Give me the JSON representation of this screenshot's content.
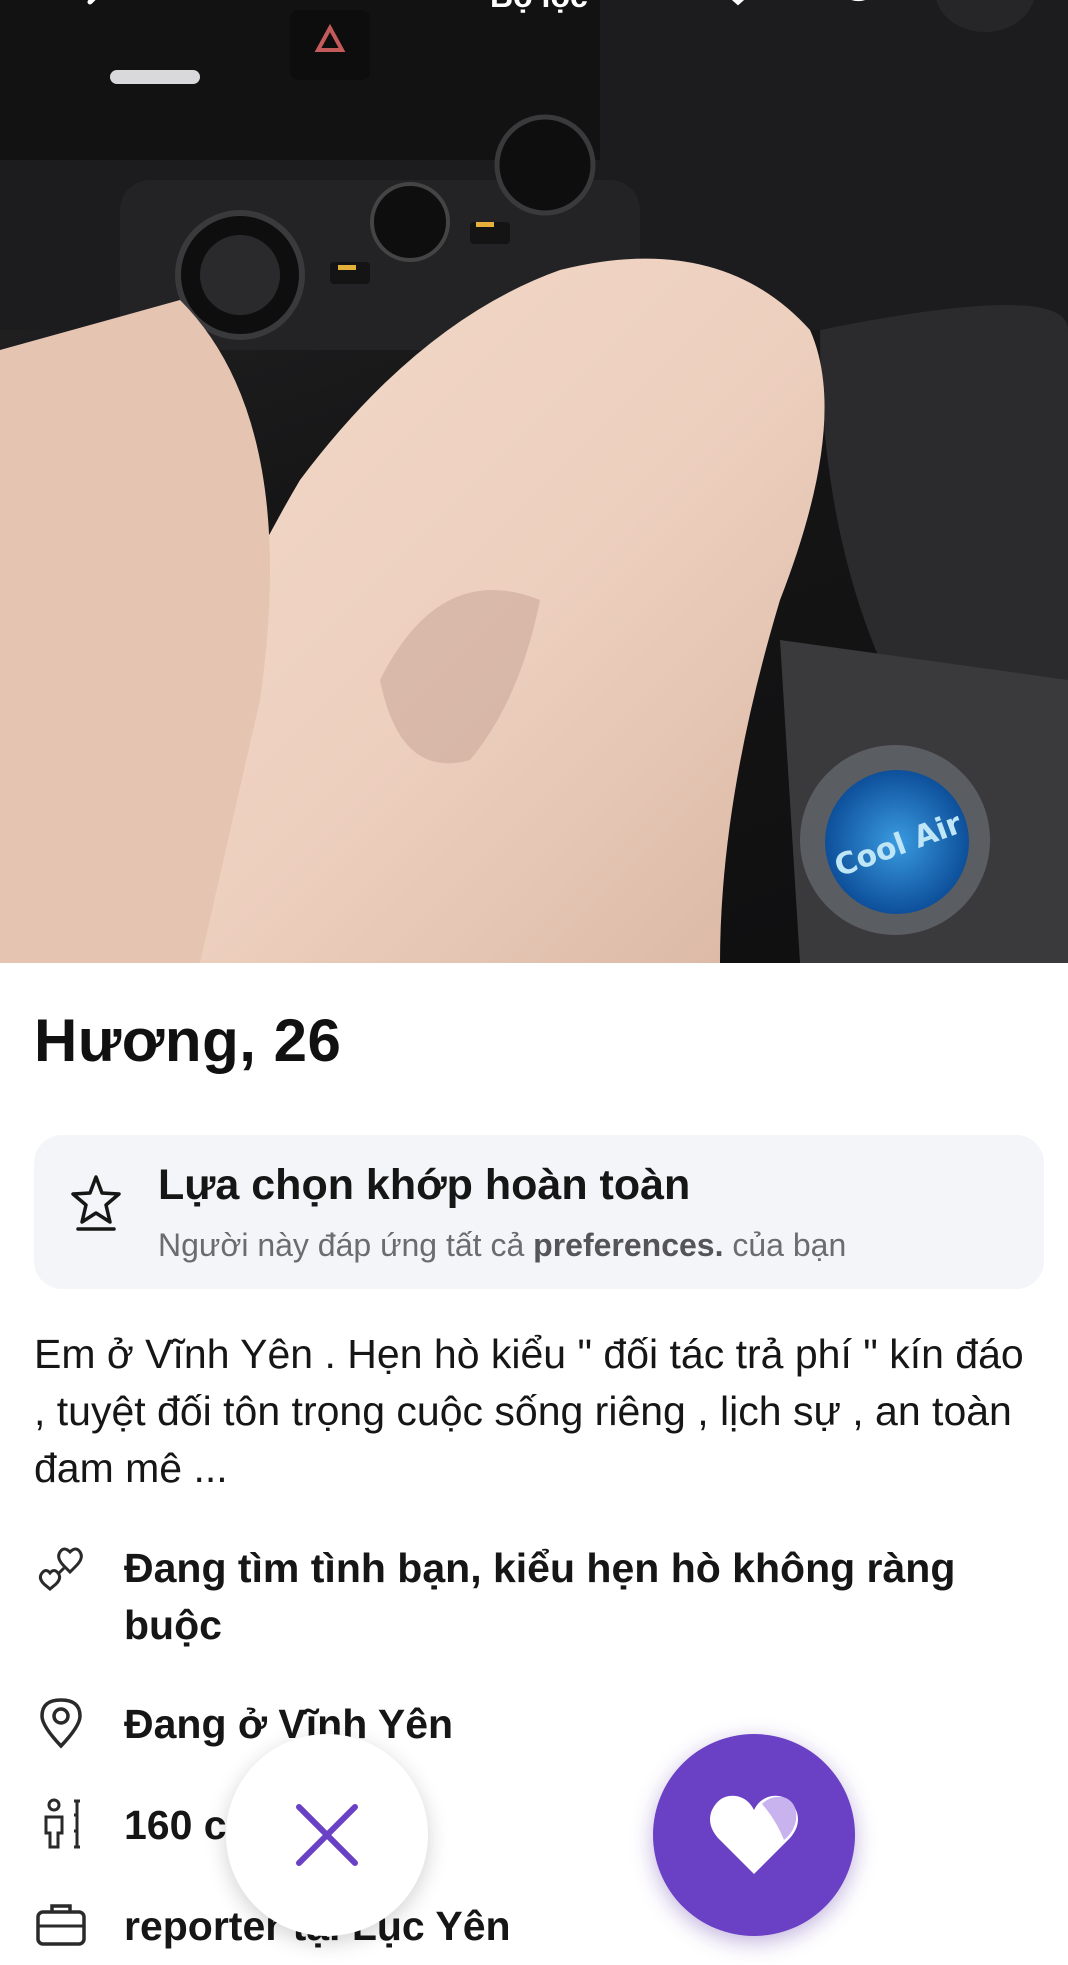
{
  "header": {
    "title": "Bộ lọc",
    "back_icon": "chevron-left-icon",
    "shield_icon": "shield-icon",
    "more_icon": "flag-icon"
  },
  "profile": {
    "name_age": "Hương, 26",
    "photo_icon": "profile-photo"
  },
  "match": {
    "icon": "star-badge-icon",
    "title": "Lựa chọn khớp hoàn toàn",
    "subtitle_prefix": "Người này đáp ứng tất cả ",
    "subtitle_bold": "preferences.",
    "subtitle_suffix": " của bạn"
  },
  "bio": "Em ở Vĩnh Yên . Hẹn hò kiểu \" đối tác trả phí \" kín đáo , tuyệt đối tôn trọng cuộc sống riêng , lịch sự , an toàn  đam mê ...",
  "details": [
    {
      "icon": "relationship-hearts-icon",
      "text": "Đang tìm tình bạn, kiểu hẹn hò không ràng buộc"
    },
    {
      "icon": "location-pin-icon",
      "text": "Đang ở Vĩnh Yên"
    },
    {
      "icon": "height-icon",
      "text": "160 cm"
    },
    {
      "icon": "briefcase-icon",
      "text": "reporter tại Lục Yên"
    }
  ],
  "actions": {
    "pass_icon": "close-icon",
    "like_icon": "heart-icon"
  },
  "colors": {
    "accent": "#6a40c5",
    "card_bg": "#f4f5f8",
    "muted_text": "#6b6b70"
  }
}
